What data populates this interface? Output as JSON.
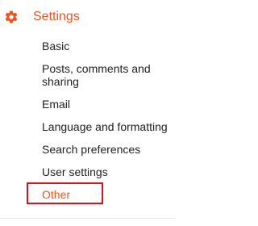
{
  "header": {
    "icon": "gear-icon",
    "label": "Settings"
  },
  "menu_items": [
    {
      "label": "Basic"
    },
    {
      "label": "Posts, comments and sharing"
    },
    {
      "label": "Email"
    },
    {
      "label": "Language and formatting"
    },
    {
      "label": "Search preferences"
    },
    {
      "label": "User settings"
    },
    {
      "label": "Other",
      "highlighted": true
    }
  ],
  "colors": {
    "accent": "#f4511e",
    "text": "#212121",
    "highlight_border": "#e0101b"
  }
}
